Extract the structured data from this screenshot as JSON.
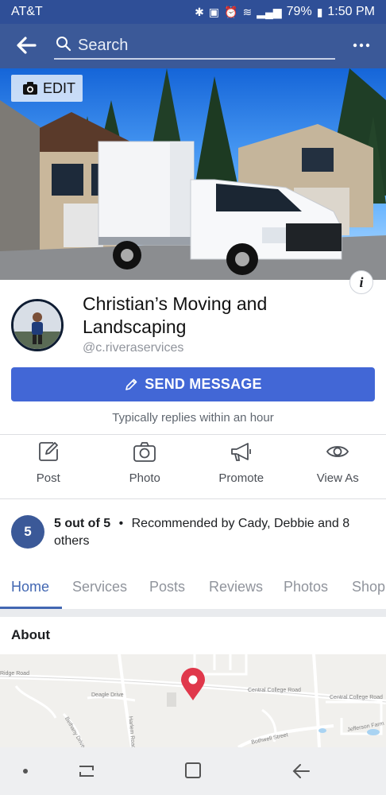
{
  "status_bar": {
    "carrier": "AT&T",
    "battery": "79%",
    "time": "1:50 PM"
  },
  "app_bar": {
    "search_placeholder": "Search"
  },
  "cover": {
    "edit_label": "EDIT"
  },
  "page": {
    "name": "Christian’s Moving and Landscaping",
    "handle": "@c.riveraservices",
    "send_message_label": "SEND MESSAGE",
    "response_note": "Typically replies within an hour"
  },
  "actions": [
    {
      "label": "Post",
      "icon": "edit-icon"
    },
    {
      "label": "Photo",
      "icon": "camera-icon"
    },
    {
      "label": "Promote",
      "icon": "megaphone-icon"
    },
    {
      "label": "View As",
      "icon": "eye-icon"
    }
  ],
  "recommendation": {
    "rating": "5",
    "score_text": "5 out of 5",
    "separator": "•",
    "summary": "Recommended by Cady, Debbie and 8 others"
  },
  "tabs": [
    {
      "label": "Home",
      "active": true
    },
    {
      "label": "Services",
      "active": false
    },
    {
      "label": "Posts",
      "active": false
    },
    {
      "label": "Reviews",
      "active": false
    },
    {
      "label": "Photos",
      "active": false
    },
    {
      "label": "Shop",
      "active": false
    }
  ],
  "about": {
    "heading": "About"
  },
  "map": {
    "streets": [
      "Ridge Road",
      "Deagle Drive",
      "Bethany Drive",
      "Harlem Road",
      "Central College Road",
      "Central College Road",
      "Bothwell Street",
      "Jefferson Farm"
    ]
  },
  "colors": {
    "brand": "#3b5998",
    "status_bar": "#2f4f97",
    "primary_button": "#4267d6",
    "active_tab": "#4267b2"
  }
}
